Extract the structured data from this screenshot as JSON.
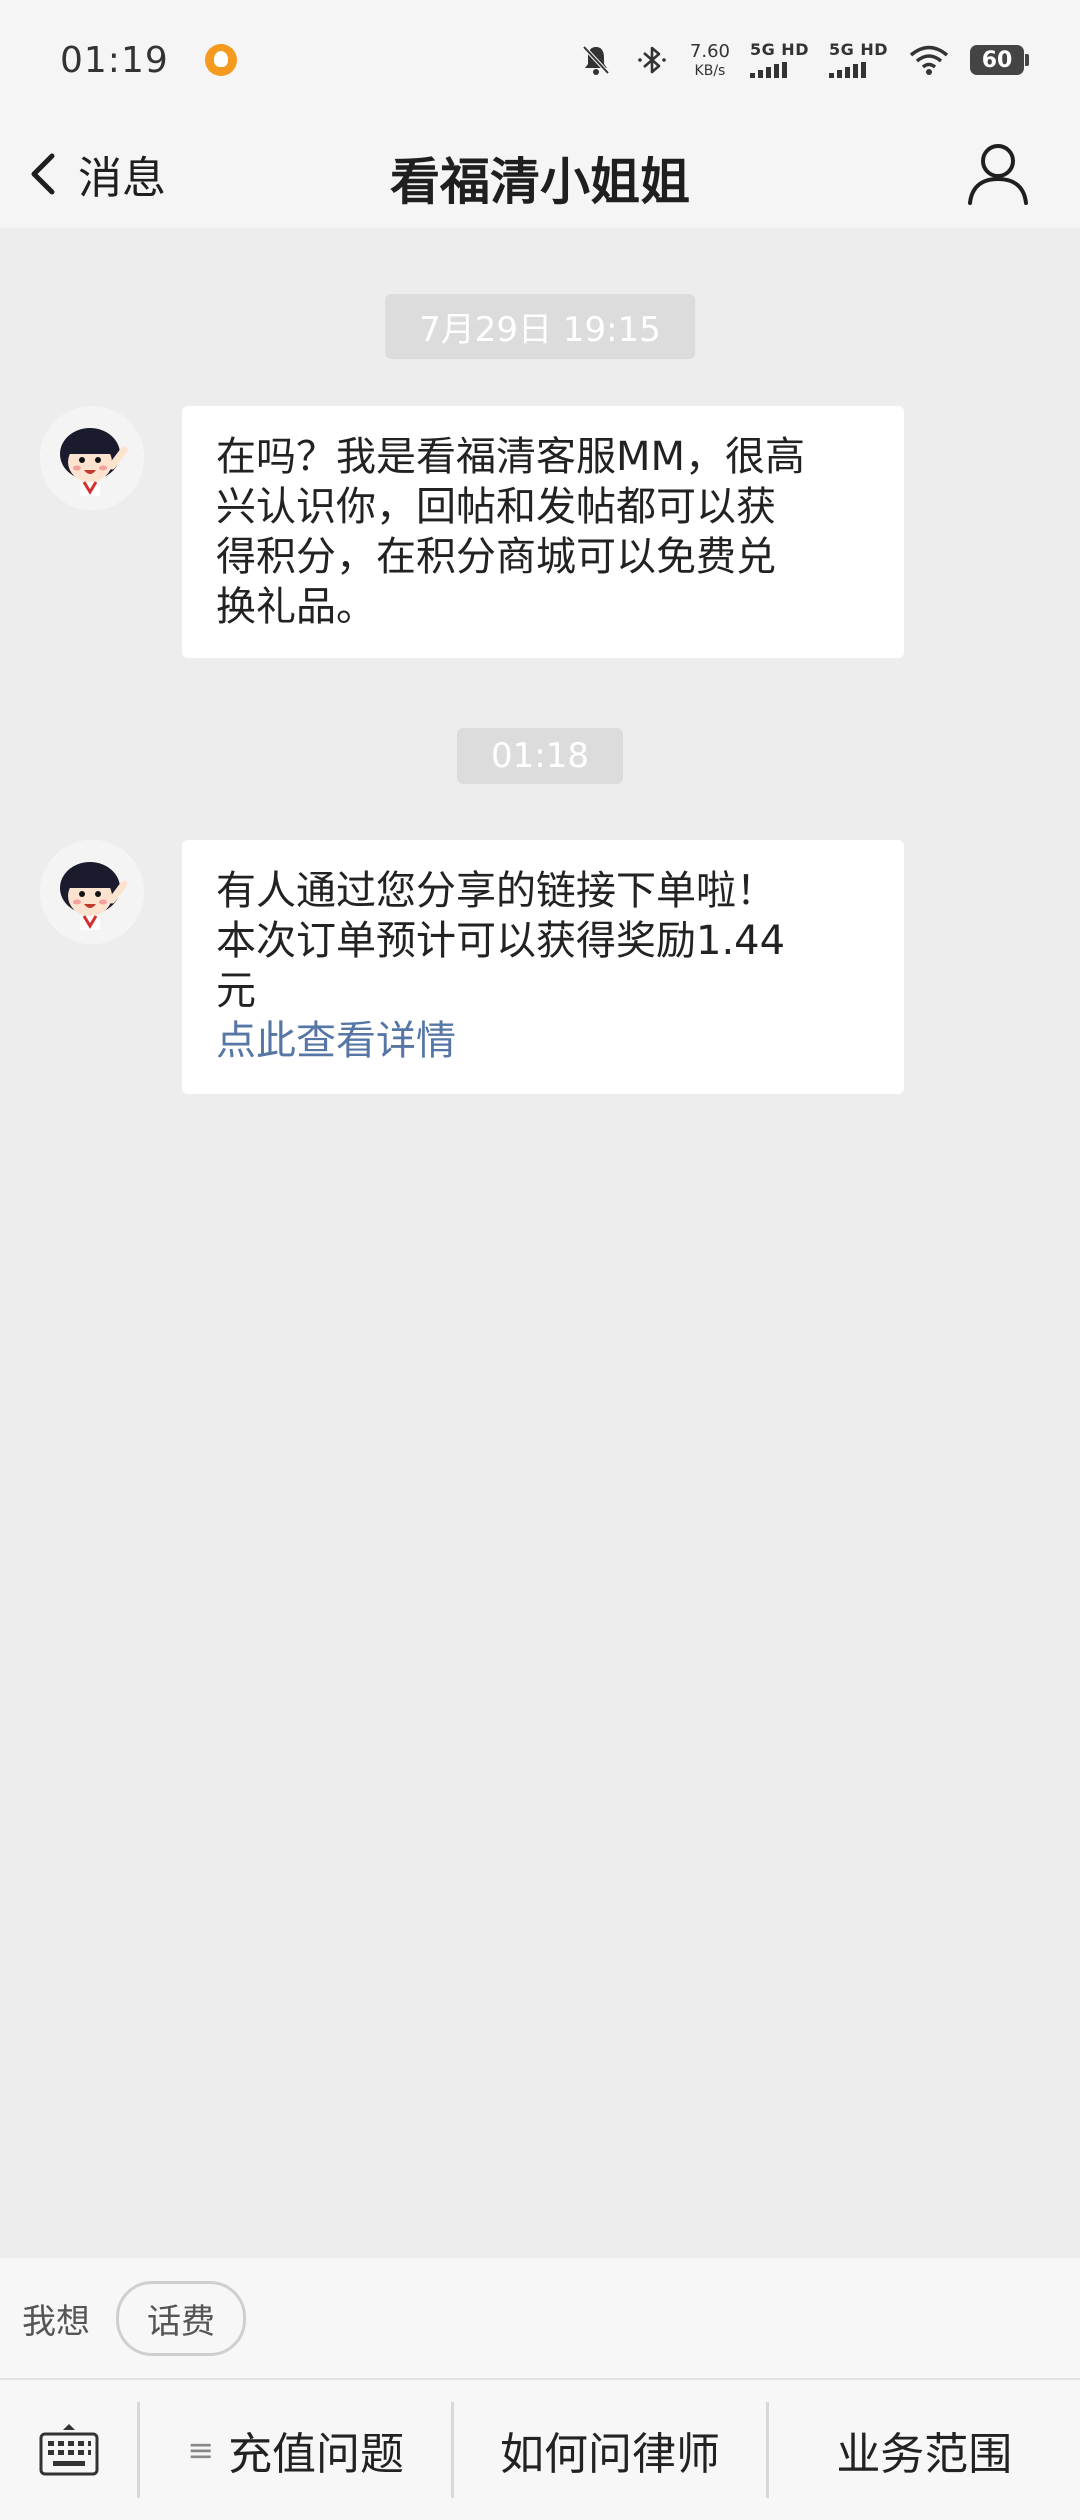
{
  "status_bar": {
    "time": "01:19",
    "net_speed_value": "7.60",
    "net_speed_unit": "KB/s",
    "sim1_label": "5G HD",
    "sim2_label": "5G HD",
    "battery": "60"
  },
  "nav": {
    "back_label": "消息",
    "title": "看福清小姐姐"
  },
  "messages": [
    {
      "timestamp": "7月29日 19:15",
      "text": "在吗？我是看福清客服MM，很高\n兴认识你，回帖和发帖都可以获\n得积分，在积分商城可以免费兑\n换礼品。"
    },
    {
      "timestamp": "01:18",
      "text": "有人通过您分享的链接下单啦！\n本次订单预计可以获得奖励1.44\n元",
      "link": "点此查看详情"
    }
  ],
  "suggest": {
    "label": "我想",
    "chip": "话费"
  },
  "menu": {
    "items": [
      "充值问题",
      "如何问律师",
      "业务范围"
    ]
  },
  "colors": {
    "link": "#5676a6",
    "background": "#ededed",
    "bubble": "#ffffff"
  }
}
